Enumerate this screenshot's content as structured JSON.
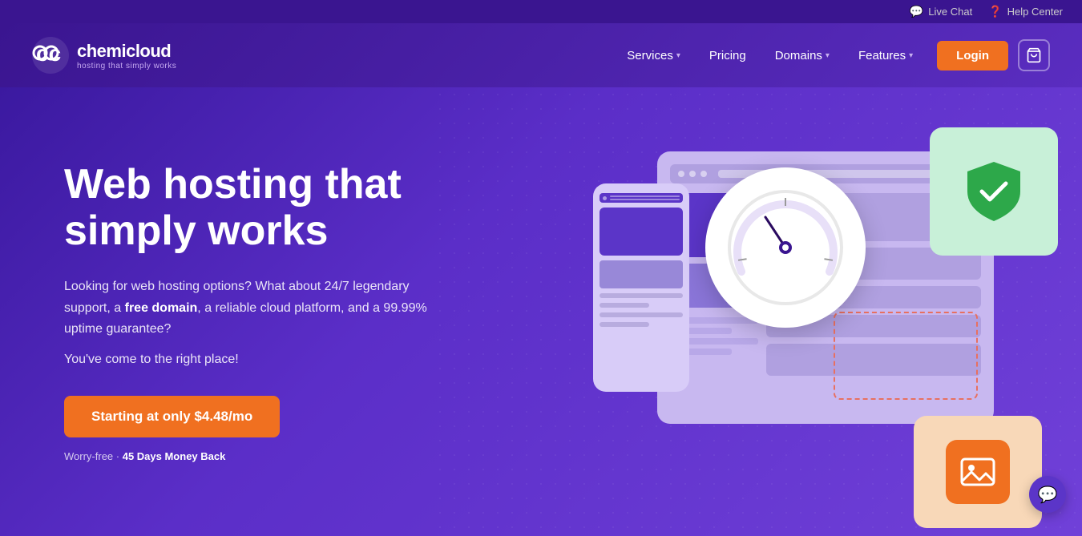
{
  "topbar": {
    "live_chat": "Live Chat",
    "help_center": "Help Center"
  },
  "navbar": {
    "logo_name": "chemicloud",
    "logo_tagline": "hosting that simply works",
    "nav_items": [
      {
        "label": "Services",
        "has_dropdown": true
      },
      {
        "label": "Pricing",
        "has_dropdown": false
      },
      {
        "label": "Domains",
        "has_dropdown": true
      },
      {
        "label": "Features",
        "has_dropdown": true
      }
    ],
    "login_label": "Login",
    "cart_icon": "🛒"
  },
  "hero": {
    "title": "Web hosting that simply works",
    "description": "Looking for web hosting options? What about 24/7 legendary support, a free domain, a reliable cloud platform, and a 99.99% uptime guarantee?",
    "description2": "You've come to the right place!",
    "cta_label": "Starting at only $4.48/mo",
    "money_back_prefix": "Worry-free · ",
    "money_back_label": "45 Days Money Back"
  },
  "chat": {
    "icon": "💬"
  },
  "colors": {
    "orange": "#f07020",
    "purple_dark": "#3a1590",
    "purple_mid": "#5b2ec8",
    "green_shield": "#2da84a",
    "bg_gradient_start": "#3b19a0",
    "bg_gradient_end": "#7040d8"
  }
}
